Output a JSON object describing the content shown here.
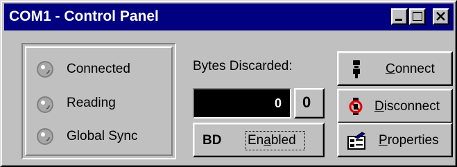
{
  "window": {
    "title": "COM1 - Control Panel",
    "controls": [
      "minimize-icon",
      "maximize-icon",
      "close-icon"
    ]
  },
  "status": {
    "items": [
      {
        "label": "Connected"
      },
      {
        "label": "Reading"
      },
      {
        "label": "Global Sync"
      }
    ]
  },
  "bytes": {
    "label": "Bytes Discarded:",
    "value": "0",
    "reset_label": "0"
  },
  "bd_toggle": {
    "prefix": "BD",
    "label_before": "En",
    "label_mnemonic": "a",
    "label_after": "bled"
  },
  "buttons": {
    "connect": {
      "mnemonic": "C",
      "rest": "onnect",
      "icon": "plug-icon"
    },
    "disconnect": {
      "mnemonic": "D",
      "rest": "isconnect",
      "icon": "unplug-icon"
    },
    "properties": {
      "mnemonic": "P",
      "rest": "roperties",
      "icon": "properties-icon"
    }
  },
  "colors": {
    "titlebar": "#000080",
    "face": "#c0c0c0",
    "counter_bg": "#000000",
    "counter_fg": "#ffffff"
  }
}
